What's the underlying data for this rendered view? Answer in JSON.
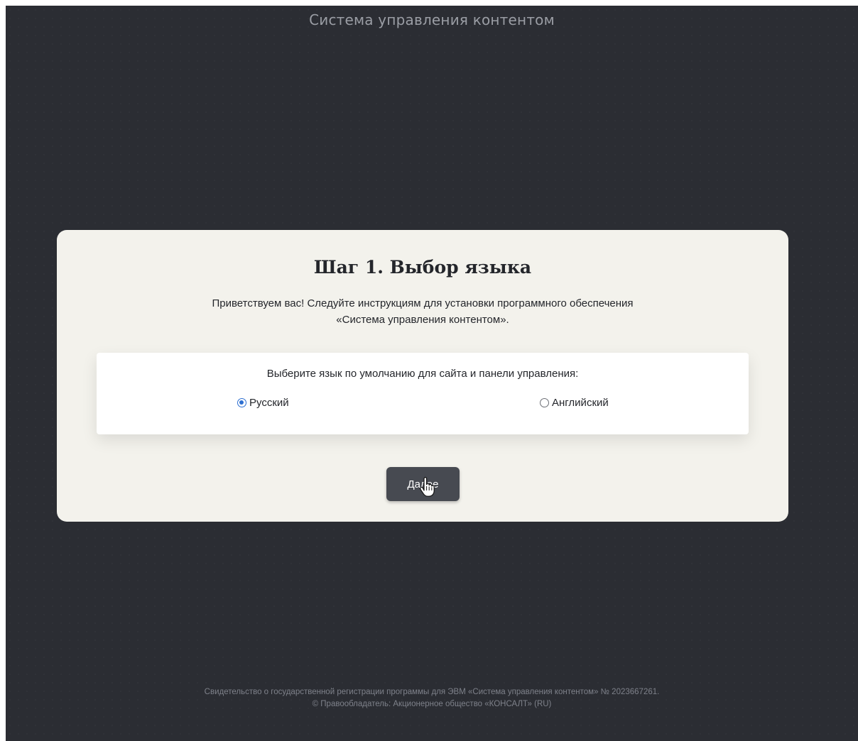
{
  "header": {
    "app_title": "Система управления контентом"
  },
  "card": {
    "step_title": "Шаг 1. Выбор языка",
    "welcome_line1": "Приветствуем вас! Следуйте инструкциям для установки программного обеспечения",
    "welcome_line2": "«Система управления контентом».",
    "language_prompt": "Выберите язык по умолчанию для сайта и панели управления:",
    "options": [
      {
        "label": "Русский",
        "checked": true
      },
      {
        "label": "Английский",
        "checked": false
      }
    ],
    "next_button": "Далее"
  },
  "footer": {
    "line1": "Свидетельство о государственной регистрации программы для ЭВМ «Система управления контентом» № 2023667261.",
    "line2": "© Правообладатель: Акционерное общество «КОНСАЛТ» (RU)"
  },
  "colors": {
    "background": "#2b2d33",
    "card": "#f3f2ec",
    "accent_radio": "#2e6fd1",
    "button": "#474a51"
  },
  "icons": {
    "cursor": "hand-pointer-icon"
  }
}
